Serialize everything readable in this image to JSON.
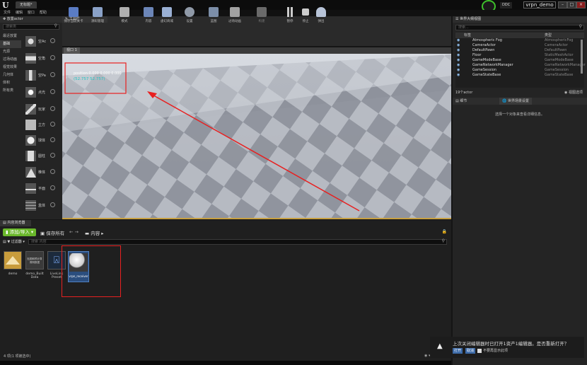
{
  "titlebar": {
    "tab": "无标题*",
    "project_prefix": "DDC",
    "project_name": "vrpn_demo"
  },
  "menu": [
    "文件",
    "编辑",
    "窗口",
    "帮助"
  ],
  "place_panel": {
    "tab": "放置actor",
    "search_placeholder": "搜索类",
    "categories": [
      "最近放置",
      "基础",
      "光源",
      "过场动画",
      "视觉效果",
      "几何体",
      "体积",
      "所有类"
    ],
    "items": [
      "空Ac",
      "空角",
      "空Pa",
      "点光",
      "玩家",
      "立方",
      "球体",
      "圆柱",
      "椎体",
      "平面",
      "盒体"
    ]
  },
  "toolbar": {
    "tab": "工具栏",
    "buttons": [
      "保存当前关卡",
      "源码管理",
      "模式",
      "内容",
      "虚幻商城",
      "设置",
      "蓝图",
      "过场动画",
      "构建",
      "暂停",
      "停止",
      "弹出"
    ]
  },
  "viewport": {
    "tab": "视口 1",
    "debug_line1": "position:0.000 0.000 0.000",
    "debug_line2": "(52.757 52.757)"
  },
  "outliner": {
    "tab": "世界大纲视图",
    "search_placeholder": "搜索...",
    "col_label": "标签",
    "col_type": "类型",
    "rows": [
      {
        "label": "Atmospheric Fog",
        "type": "AtmosphericFog"
      },
      {
        "label": "CameraActor",
        "type": "CameraActor"
      },
      {
        "label": "DefaultPawn",
        "type": "DefaultPawn"
      },
      {
        "label": "Floor",
        "type": "StaticMeshActor"
      },
      {
        "label": "GameModeBase",
        "type": "GameModeBase"
      },
      {
        "label": "GameNetworkManager",
        "type": "GameNetworkManager"
      },
      {
        "label": "GameSession",
        "type": "GameSession"
      },
      {
        "label": "GameStateBase",
        "type": "GameStateBase"
      }
    ],
    "count": "19个actor",
    "view_options": "视图选项"
  },
  "details": {
    "tab": "细节",
    "tab2": "世界场景设置",
    "hint": "选择一个对象来查看详细信息。"
  },
  "content_browser": {
    "tab": "内容浏览器",
    "add_import": "添加/导入",
    "save_all": "保存所有",
    "path": "内容",
    "filters": "过滤器",
    "search_placeholder": "搜索 内容",
    "assets": [
      {
        "name": "demo",
        "thumb_text": ""
      },
      {
        "name": "demo_Built Data",
        "thumb_text": "贴图和预计算照明数据"
      },
      {
        "name": "LiveLink Preset",
        "thumb_text": ""
      },
      {
        "name": "vrpn_receiver",
        "thumb_text": ""
      }
    ],
    "status": "4 项(1 项被选中)"
  },
  "notification": {
    "message": "上次关闭编辑器时已打开1资产1编辑器。是否重新打开？",
    "open_btn": "打开",
    "cancel_btn": "取消",
    "dont_show": "不要再显示此项"
  },
  "colors": {
    "accent_green": "#6ab82b",
    "highlight_red": "#e82020",
    "selection_blue": "#244a7a"
  }
}
